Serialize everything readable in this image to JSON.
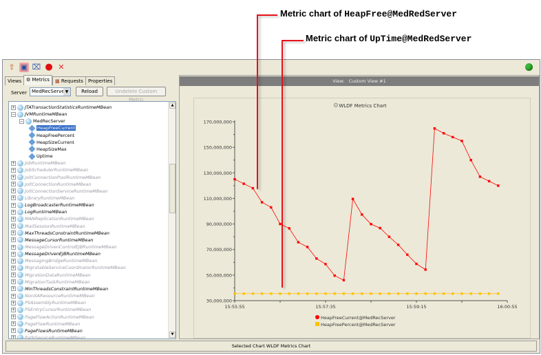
{
  "callouts": [
    {
      "prefix": "Metric chart of ",
      "metric": "HeapFree@MedRedServer"
    },
    {
      "prefix": "Metric chart of ",
      "metric": "UpTime@MedRedServer"
    }
  ],
  "toolbar": {
    "icons": [
      "export-icon",
      "save-icon",
      "delete-chart-icon",
      "record-icon",
      "close-icon"
    ],
    "status_color": "#3cb83c"
  },
  "tabs": [
    "Views",
    "Metrics",
    "Requests",
    "Properties"
  ],
  "server": {
    "label": "Server",
    "value": "MedRecServer",
    "reload": "Reload",
    "undelete": "Undelete Custom Metric"
  },
  "tree": [
    {
      "label": "JTATransactionStatisticsRuntimeMBean",
      "level": 0,
      "style": "bold"
    },
    {
      "label": "JVMRuntimeMBean",
      "level": 0,
      "style": "bold",
      "expanded": true
    },
    {
      "label": "MedRecServer",
      "level": 1,
      "style": "plain",
      "expanded": true
    },
    {
      "label": "HeapFreeCurrent",
      "level": 2,
      "style": "selected"
    },
    {
      "label": "HeapFreePercent",
      "level": 2,
      "style": "plain"
    },
    {
      "label": "HeapSizeCurrent",
      "level": 2,
      "style": "plain"
    },
    {
      "label": "HeapSizeMax",
      "level": 2,
      "style": "plain"
    },
    {
      "label": "Uptime",
      "level": 2,
      "style": "plain"
    },
    {
      "label": "JobRuntimeMBean",
      "level": 0,
      "style": "dim"
    },
    {
      "label": "JobSchedulerRuntimeMBean",
      "level": 0,
      "style": "dim"
    },
    {
      "label": "JoltConnectionPoolRuntimeMBean",
      "level": 0,
      "style": "dim"
    },
    {
      "label": "JoltConnectionRuntimeMBean",
      "level": 0,
      "style": "dim"
    },
    {
      "label": "JoltConnectionServiceRuntimeMBean",
      "level": 0,
      "style": "dim"
    },
    {
      "label": "LibraryRuntimeMBean",
      "level": 0,
      "style": "dim"
    },
    {
      "label": "LogBroadcasterRuntimeMBean",
      "level": 0,
      "style": "bold"
    },
    {
      "label": "LogRuntimeMBean",
      "level": 0,
      "style": "bold"
    },
    {
      "label": "MANReplicationRuntimeMBean",
      "level": 0,
      "style": "dim"
    },
    {
      "label": "MailSessionRuntimeMBean",
      "level": 0,
      "style": "dim"
    },
    {
      "label": "MaxThreadsConstraintRuntimeMBean",
      "level": 0,
      "style": "bold"
    },
    {
      "label": "MessageCursorRuntimeMBean",
      "level": 0,
      "style": "bold"
    },
    {
      "label": "MessageDrivenControlEJBRuntimeMBean",
      "level": 0,
      "style": "dim"
    },
    {
      "label": "MessageDrivenEJBRuntimeMBean",
      "level": 0,
      "style": "bold"
    },
    {
      "label": "MessagingBridgeRuntimeMBean",
      "level": 0,
      "style": "dim"
    },
    {
      "label": "MigratableServiceCoordinatorRuntimeMBean",
      "level": 0,
      "style": "dim"
    },
    {
      "label": "MigrationDataRuntimeMBean",
      "level": 0,
      "style": "dim"
    },
    {
      "label": "MigrationTaskRuntimeMBean",
      "level": 0,
      "style": "dim"
    },
    {
      "label": "MinThreadsConstraintRuntimeMBean",
      "level": 0,
      "style": "bold"
    },
    {
      "label": "NonXAResourceRuntimeMBean",
      "level": 0,
      "style": "dim"
    },
    {
      "label": "PSAssemblyRuntimeMBean",
      "level": 0,
      "style": "dim"
    },
    {
      "label": "PSEntryCursorRuntimeMBean",
      "level": 0,
      "style": "dim"
    },
    {
      "label": "PageFlowActionRuntimeMBean",
      "level": 0,
      "style": "dim"
    },
    {
      "label": "PageFlowRuntimeMBean",
      "level": 0,
      "style": "dim"
    },
    {
      "label": "PageFlowsRuntimeMBean",
      "level": 0,
      "style": "bold"
    },
    {
      "label": "PathServiceRuntimeMBean",
      "level": 0,
      "style": "dim"
    }
  ],
  "view": {
    "label": "View:",
    "name": "Custom View #1"
  },
  "status": "Selected Chart WLDF Metrics Chart",
  "chart_data": {
    "type": "line",
    "title": "WLDF Metrics Chart",
    "xlabel": "",
    "ylabel": "",
    "x_ticks": [
      "15:55:55",
      "15:57:35",
      "15:59:15",
      "16:00:55"
    ],
    "x_range_seconds": [
      0,
      300
    ],
    "y_ticks": [
      "170,000,000",
      "150,000,000",
      "130,000,000",
      "110,000,000",
      "90,000,000",
      "70,000,000",
      "50,000,000",
      "30,000,000"
    ],
    "ylim": [
      30000000,
      170000000
    ],
    "x_seconds": [
      0,
      10,
      20,
      30,
      40,
      50,
      60,
      70,
      80,
      90,
      100,
      110,
      120,
      130,
      140,
      150,
      160,
      170,
      180,
      190,
      200,
      210,
      220,
      230,
      240,
      250,
      260,
      270,
      280,
      290
    ],
    "series": [
      {
        "name": "HeapFreeCurrent@MedRecServer",
        "color": "#ff0000",
        "values": [
          125000000,
          121500000,
          118000000,
          107000000,
          103000000,
          90000000,
          86600000,
          75700000,
          72000000,
          63000000,
          58600000,
          49600000,
          46000000,
          109600000,
          97400000,
          89900000,
          86800000,
          80000000,
          73700000,
          66000000,
          58800000,
          54300000,
          164800000,
          161000000,
          158000000,
          155000000,
          140000000,
          127000000,
          123500000,
          120000000
        ]
      },
      {
        "name": "HeapFreePercent@MedRecServer",
        "color": "#ffc000",
        "values": [
          35500000,
          35500000,
          35500000,
          35500000,
          35500000,
          35500000,
          35500000,
          35500000,
          35500000,
          35500000,
          35500000,
          35500000,
          35500000,
          35500000,
          35500000,
          35500000,
          35500000,
          35500000,
          35500000,
          35500000,
          35500000,
          35500000,
          35500000,
          35500000,
          35500000,
          35500000,
          35500000,
          35500000,
          35500000,
          35500000
        ]
      }
    ],
    "legend": "bottom"
  }
}
